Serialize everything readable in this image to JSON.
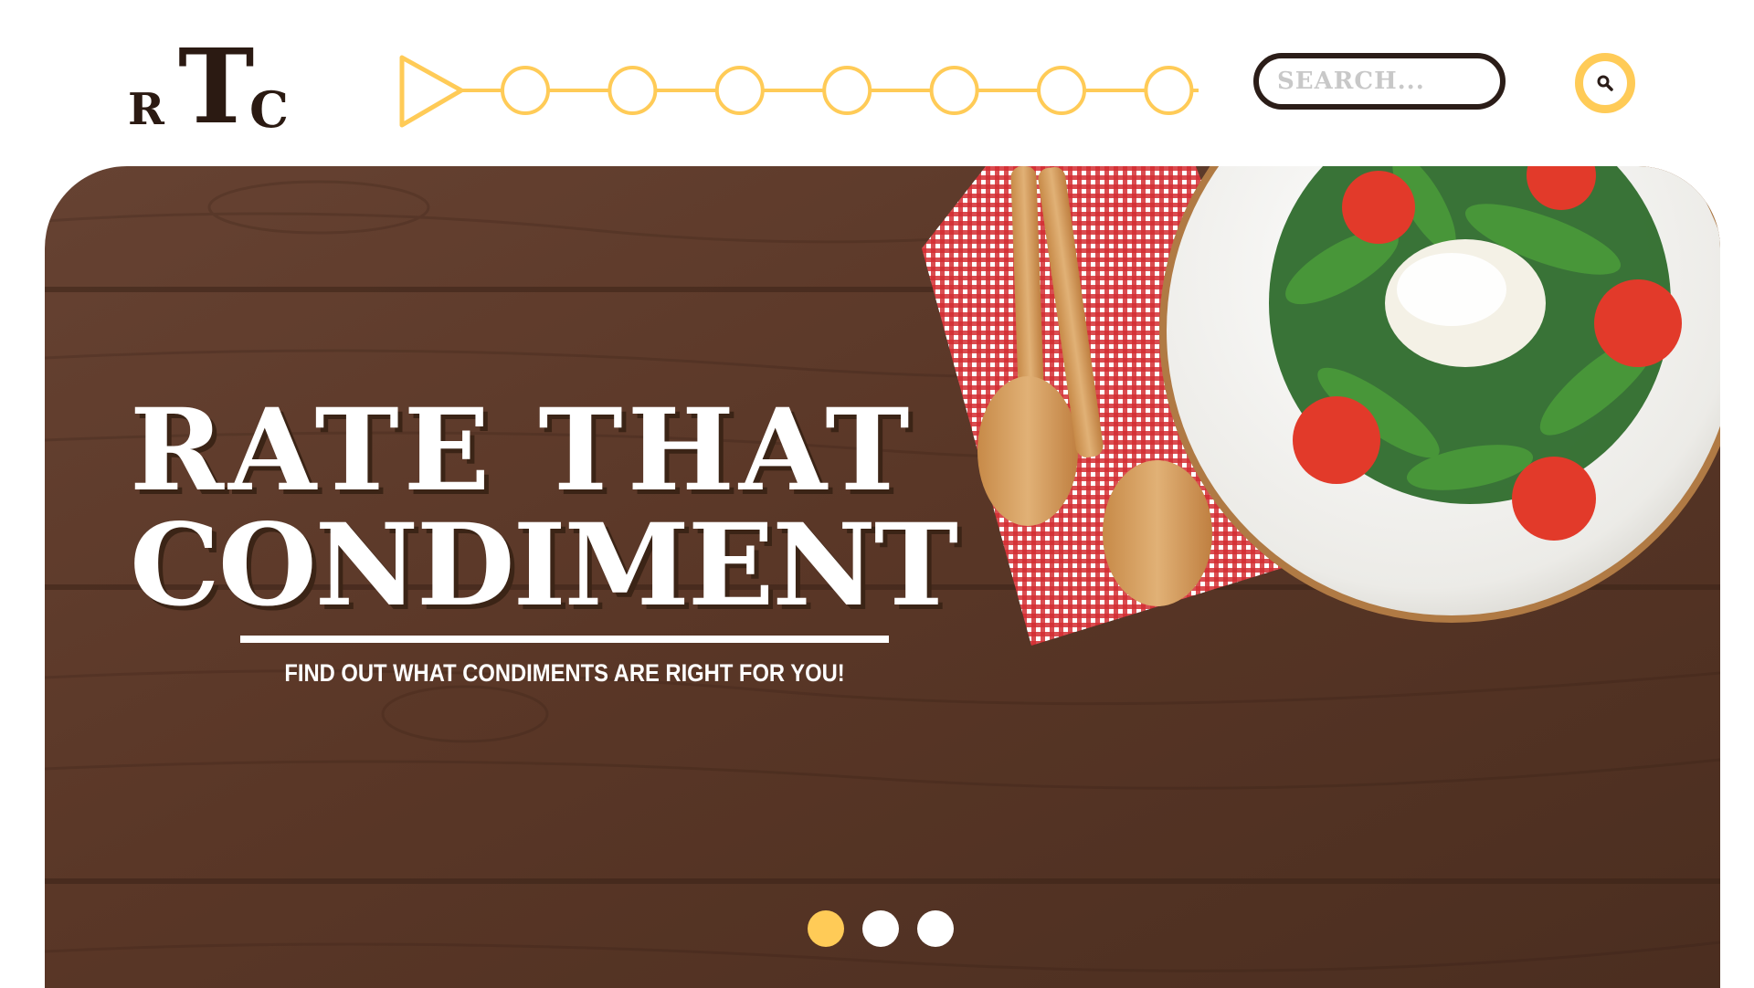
{
  "brand": {
    "logo_letters": [
      "R",
      "T",
      "C"
    ]
  },
  "nav": {
    "step_count": 8
  },
  "search": {
    "placeholder": "SEARCH..."
  },
  "hero": {
    "title_line1": "RATE THAT",
    "title_line2": "CONDIMENT",
    "subtitle": "FIND OUT WHAT CONDIMENTS ARE RIGHT FOR YOU!"
  },
  "pager": {
    "count": 3,
    "active_index": 0
  },
  "colors": {
    "accent": "#ffcb57",
    "dark": "#2b1d18",
    "wood": "#5b3826",
    "tablecloth": "#d42e33"
  },
  "icons": {
    "nav_start": "play-triangle-icon",
    "search": "search-icon"
  }
}
